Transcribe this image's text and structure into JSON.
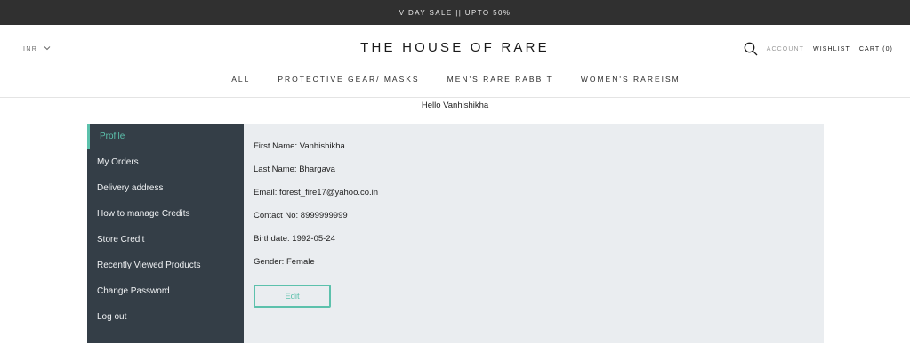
{
  "announcement": "V DAY SALE || UPTO 50%",
  "header": {
    "currency": "INR",
    "logo": "THE HOUSE OF RARE",
    "search_icon": "search-icon",
    "account": "ACCOUNT",
    "wishlist": "WISHLIST",
    "cart": "CART (0)"
  },
  "menu": {
    "all": "ALL",
    "protective": "PROTECTIVE GEAR/ MASKS",
    "mens": "MEN'S RARE RABBIT",
    "womens": "WOMEN'S RAREISM"
  },
  "greeting": "Hello Vanhishikha",
  "sidebar": {
    "items": [
      "Profile",
      "My Orders",
      "Delivery address",
      "How to manage Credits",
      "Store Credit",
      "Recently Viewed Products",
      "Change Password",
      "Log out"
    ],
    "active_index": 0
  },
  "profile": {
    "first_name": "First Name: Vanhishikha",
    "last_name": "Last Name: Bhargava",
    "email": "Email: forest_fire17@yahoo.co.in",
    "contact": "Contact No: 8999999999",
    "birthdate": "Birthdate: 1992-05-24",
    "gender": "Gender: Female",
    "edit_label": "Edit"
  },
  "colors": {
    "announcement_bg": "#303030",
    "sidebar_bg": "#343e47",
    "accent": "#5cc1ac",
    "content_bg": "#eaedf0"
  }
}
